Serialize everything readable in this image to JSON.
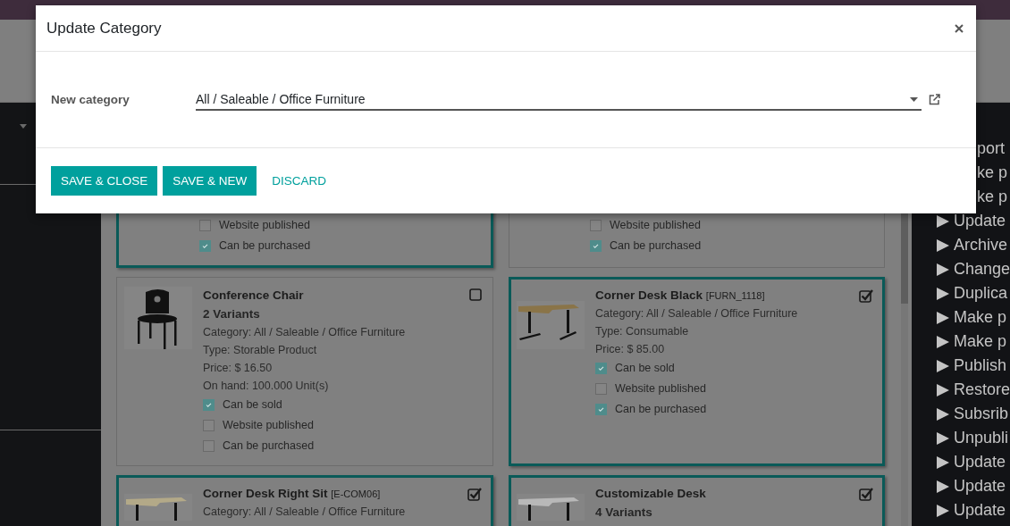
{
  "dialog": {
    "title": "Update Category",
    "field": {
      "label": "New category",
      "value": "All / Saleable / Office Furniture"
    },
    "buttons": [
      {
        "label": "SAVE & CLOSE",
        "kind": "primary"
      },
      {
        "label": "SAVE & NEW",
        "kind": "primary"
      },
      {
        "label": "DISCARD",
        "kind": "link"
      }
    ]
  },
  "cards": [
    {
      "kind": "tail",
      "selected": true,
      "flags": [
        {
          "label": "Website published",
          "checked": false
        },
        {
          "label": "Can be purchased",
          "checked": true
        }
      ]
    },
    {
      "kind": "tail",
      "selected": false,
      "flags": [
        {
          "label": "Website published",
          "checked": false
        },
        {
          "label": "Can be purchased",
          "checked": true
        }
      ]
    },
    {
      "kind": "product",
      "selected": false,
      "name": "Conference Chair",
      "variants": "2 Variants",
      "details": [
        "Category: All / Saleable / Office Furniture",
        "Type: Storable Product",
        "Price: $ 16.50",
        "On hand: 100.000 Unit(s)"
      ],
      "flags": [
        {
          "label": "Can be sold",
          "checked": true
        },
        {
          "label": "Website published",
          "checked": false
        },
        {
          "label": "Can be purchased",
          "checked": false
        }
      ]
    },
    {
      "kind": "product",
      "selected": true,
      "name": "Corner Desk Black",
      "reference": "[FURN_1118]",
      "details": [
        "Category: All / Saleable / Office Furniture",
        "Type: Consumable",
        "Price: $ 85.00"
      ],
      "flags": [
        {
          "label": "Can be sold",
          "checked": true
        },
        {
          "label": "Website published",
          "checked": false
        },
        {
          "label": "Can be purchased",
          "checked": true
        }
      ]
    },
    {
      "kind": "product",
      "selected": true,
      "name": "Corner Desk Right Sit",
      "reference": "[E-COM06]",
      "details": [
        "Category: All / Saleable / Office Furniture"
      ]
    },
    {
      "kind": "product",
      "selected": true,
      "name": "Customizable Desk",
      "variants": "4 Variants"
    }
  ],
  "actions": [
    {
      "label": "port",
      "kind": "partial"
    },
    {
      "label": "ke p",
      "kind": "partial"
    },
    {
      "label": "ke p",
      "kind": "partial"
    },
    {
      "label": "Update",
      "kind": "action"
    },
    {
      "label": "Archive",
      "kind": "action"
    },
    {
      "label": "Change",
      "kind": "action"
    },
    {
      "label": "Duplica",
      "kind": "action"
    },
    {
      "label": "Make p",
      "kind": "action"
    },
    {
      "label": "Make p",
      "kind": "action"
    },
    {
      "label": "Publish",
      "kind": "action"
    },
    {
      "label": "Restore",
      "kind": "action"
    },
    {
      "label": "Subsrib",
      "kind": "action"
    },
    {
      "label": "Unpubli",
      "kind": "action"
    },
    {
      "label": "Update",
      "kind": "action"
    },
    {
      "label": "Update",
      "kind": "action"
    },
    {
      "label": "Update",
      "kind": "action"
    }
  ]
}
